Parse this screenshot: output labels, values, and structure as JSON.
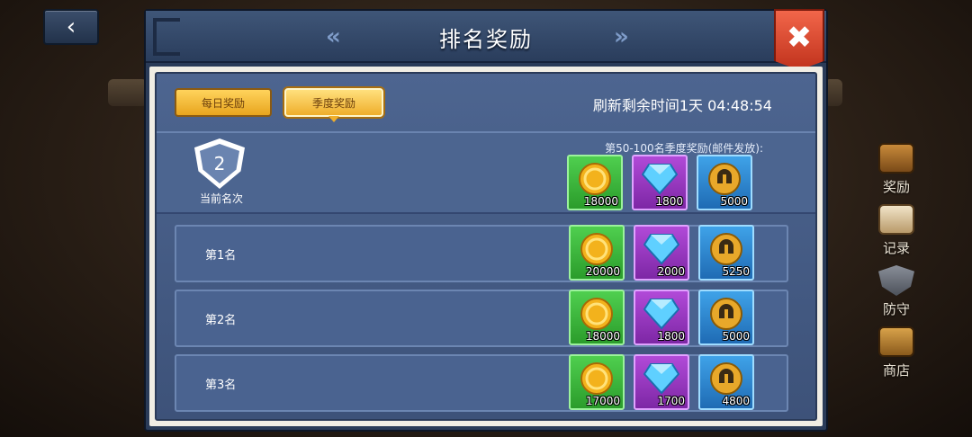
{
  "header": {
    "title": "排名奖励",
    "back_icon": "‹",
    "prev_icon": "«",
    "next_icon": "»",
    "close_icon": "✖"
  },
  "tabs": [
    {
      "label": "每日奖励",
      "active": false
    },
    {
      "label": "季度奖励",
      "active": true
    }
  ],
  "refresh_text": "刷新剩余时间1天 04:48:54",
  "current": {
    "rank": "2",
    "label": "当前名次",
    "caption": "第50-100名季度奖励(邮件发放):",
    "rewards": [
      "18000",
      "1800",
      "5000"
    ]
  },
  "ranks": [
    {
      "label": "第1名",
      "rewards": [
        "20000",
        "2000",
        "5250"
      ]
    },
    {
      "label": "第2名",
      "rewards": [
        "18000",
        "1800",
        "5000"
      ]
    },
    {
      "label": "第3名",
      "rewards": [
        "17000",
        "1700",
        "4800"
      ]
    }
  ],
  "reward_types": [
    {
      "icon": "gold-coin-icon",
      "color": "green"
    },
    {
      "icon": "diamond-icon",
      "color": "purple"
    },
    {
      "icon": "helmet-token-icon",
      "color": "blue"
    }
  ],
  "side_menu": [
    {
      "label": "奖励",
      "icon": "treasure-chest-icon"
    },
    {
      "label": "记录",
      "icon": "scroll-icon"
    },
    {
      "label": "防守",
      "icon": "shield-icon"
    },
    {
      "label": "商店",
      "icon": "shop-cart-icon"
    }
  ]
}
